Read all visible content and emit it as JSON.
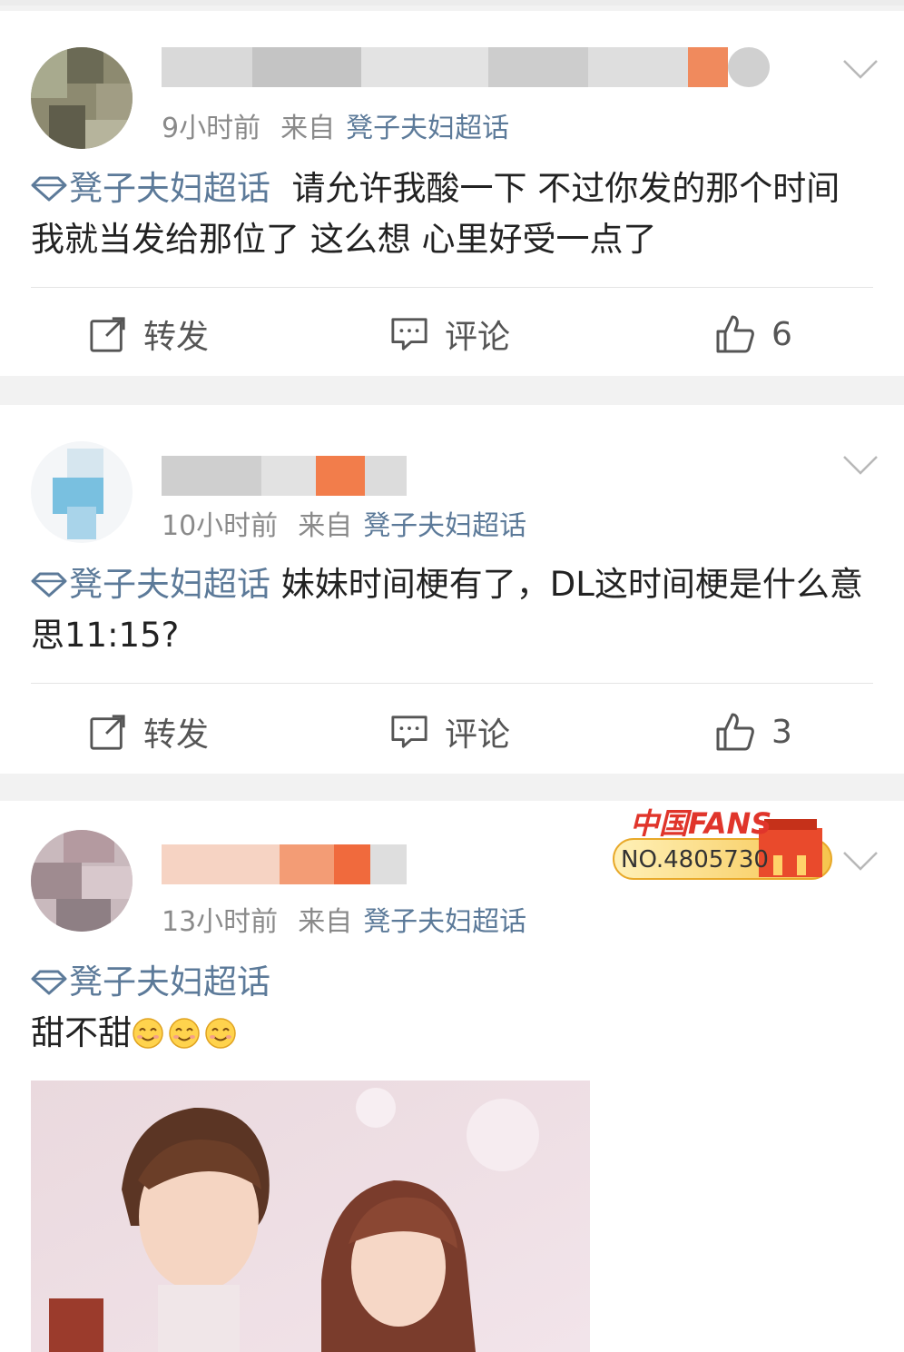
{
  "colors": {
    "link": "#5c7a99",
    "meta": "#8a8a8a",
    "text": "#222222",
    "divider": "#e4e4e4"
  },
  "posts": [
    {
      "time": "9小时前",
      "source_prefix": "来自",
      "source": "凳子夫妇超话",
      "tag": "凳子夫妇超话",
      "body": "请允许我酸一下 不过你发的那个时间 我就当发给那位了 这么想 心里好受一点了",
      "actions": {
        "repost": "转发",
        "comment": "评论",
        "like_count": "6"
      },
      "icons": [
        "blurred-avatar",
        "chevron-down-icon",
        "supertopic-diamond-icon",
        "repost-icon",
        "comment-icon",
        "like-icon"
      ]
    },
    {
      "time": "10小时前",
      "source_prefix": "来自",
      "source": "凳子夫妇超话",
      "tag": "凳子夫妇超话",
      "body": "妹妹时间梗有了，DL这时间梗是什么意思11:15?",
      "actions": {
        "repost": "转发",
        "comment": "评论",
        "like_count": "3"
      },
      "icons": [
        "blurred-avatar",
        "chevron-down-icon",
        "supertopic-diamond-icon",
        "repost-icon",
        "comment-icon",
        "like-icon"
      ]
    },
    {
      "time": "13小时前",
      "source_prefix": "来自",
      "source": "凳子夫妇超话",
      "tag": "凳子夫妇超话",
      "body": "甜不甜",
      "emoji": [
        "smile-emoji",
        "smile-emoji",
        "smile-emoji"
      ],
      "badge": {
        "logo_text": "中国FANS",
        "number": "NO.4805730"
      },
      "icons": [
        "blurred-avatar",
        "chevron-down-icon",
        "supertopic-diamond-icon",
        "fans-badge-icon"
      ]
    }
  ]
}
